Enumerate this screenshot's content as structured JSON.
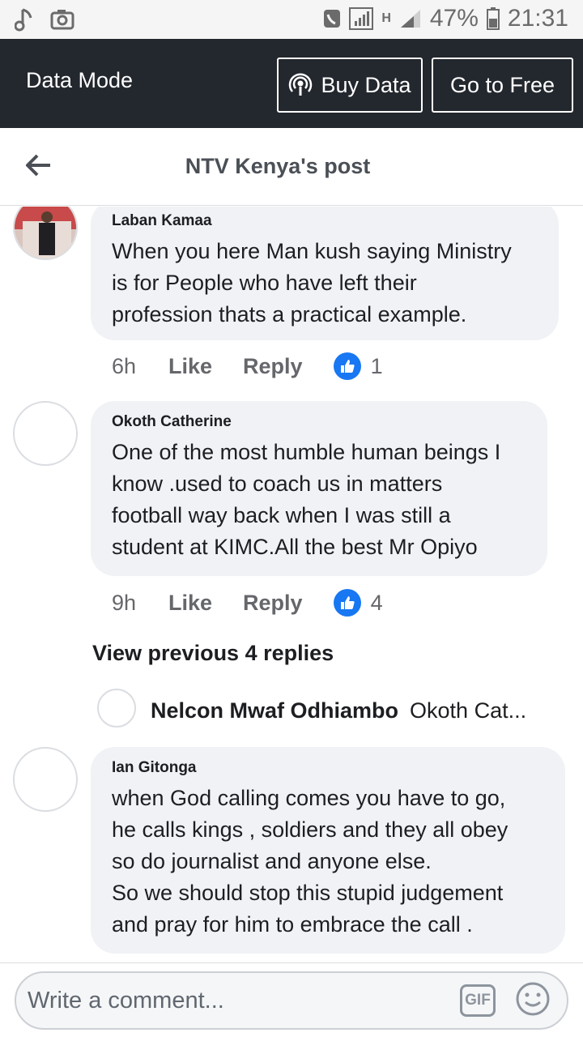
{
  "status_bar": {
    "battery": "47%",
    "time": "21:31",
    "network": "H"
  },
  "data_bar": {
    "mode_label": "Data Mode",
    "buy_label": "Buy Data",
    "free_label": "Go to Free"
  },
  "header": {
    "title": "NTV Kenya's post"
  },
  "comments": [
    {
      "author": "Laban Kamaa",
      "text": "When you here Man kush saying Ministry\nis for People who have left their\nprofession thats a practical example.",
      "time": "6h",
      "like": "Like",
      "reply": "Reply",
      "likes": "1"
    },
    {
      "author": "Okoth Catherine",
      "text": "One of the most humble human beings I\nknow .used to coach us in matters\nfootball way back when I was still a\nstudent at KIMC.All the best Mr Opiyo",
      "time": "9h",
      "like": "Like",
      "reply": "Reply",
      "likes": "4"
    },
    {
      "author": "Ian Gitonga",
      "text": "when God calling comes you have to go,\nhe calls kings , soldiers  and  they all obey\nso do journalist and anyone else.\nSo we should stop this stupid judgement\nand pray for him to embrace the call ."
    }
  ],
  "replies": {
    "view_previous": "View previous 4 replies",
    "latest_name": "Nelcon Mwaf Odhiambo",
    "latest_preview": "Okoth Cat..."
  },
  "composer": {
    "placeholder": "Write a comment...",
    "gif": "GIF"
  },
  "colors": {
    "like_blue": "#1877f2",
    "data_bar": "#23272e",
    "bubble": "#f0f2f5"
  }
}
